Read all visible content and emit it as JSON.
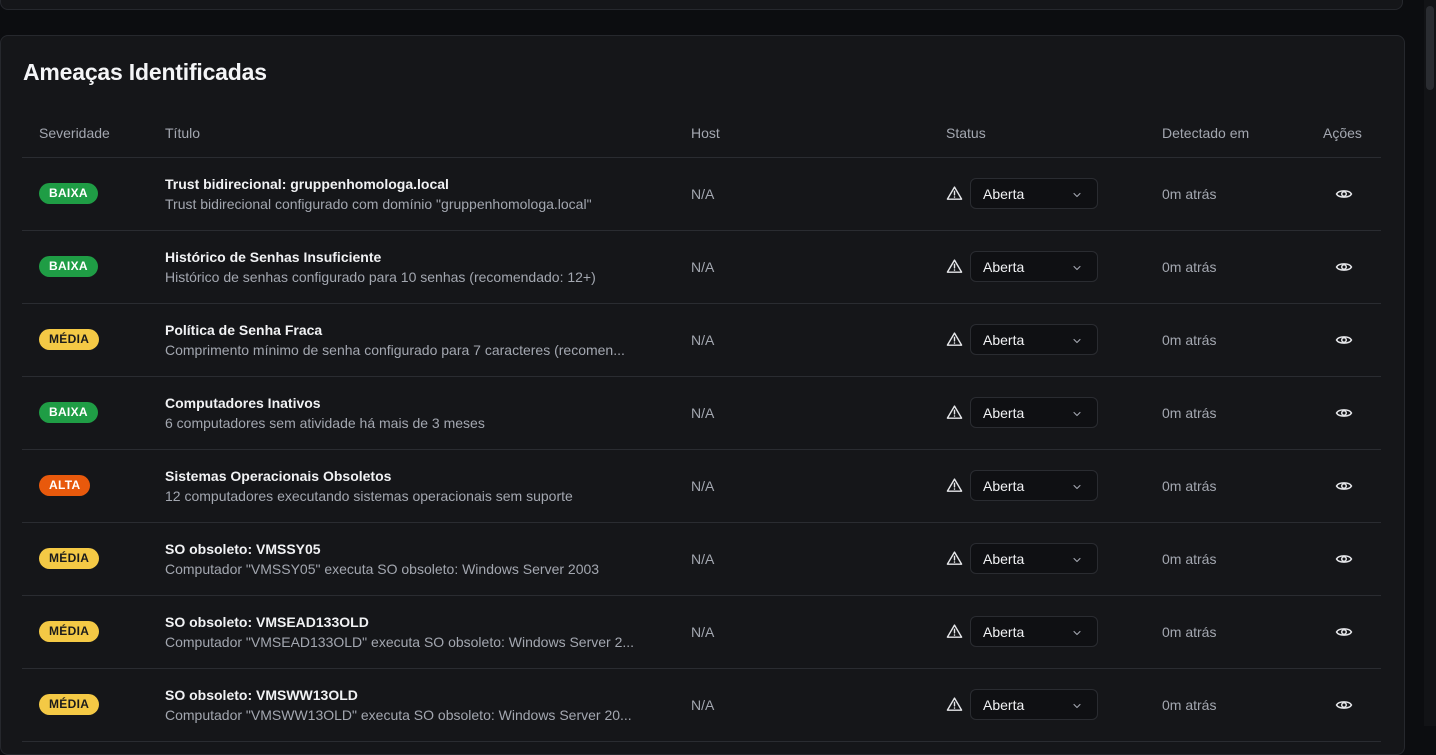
{
  "section": {
    "title": "Ameaças Identificadas"
  },
  "columns": {
    "severity": "Severidade",
    "title": "Título",
    "host": "Host",
    "status": "Status",
    "detected": "Detectado em",
    "actions": "Ações"
  },
  "icons": {
    "warning": "alert-triangle-icon",
    "view": "eye-icon",
    "dropdown": "chevron-down-icon"
  },
  "colors": {
    "baixa": "#1f9d45",
    "media": "#f4c945",
    "alta": "#e8590c"
  },
  "threats": [
    {
      "severity": "BAIXA",
      "level": "baixa",
      "title": "Trust bidirecional: gruppenhomologa.local",
      "description": "Trust bidirecional configurado com domínio \"gruppenhomologa.local\"",
      "host": "N/A",
      "status": "Aberta",
      "detected": "0m atrás"
    },
    {
      "severity": "BAIXA",
      "level": "baixa",
      "title": "Histórico de Senhas Insuficiente",
      "description": "Histórico de senhas configurado para 10 senhas (recomendado: 12+)",
      "host": "N/A",
      "status": "Aberta",
      "detected": "0m atrás"
    },
    {
      "severity": "MÉDIA",
      "level": "media",
      "title": "Política de Senha Fraca",
      "description": "Comprimento mínimo de senha configurado para 7 caracteres (recomen...",
      "host": "N/A",
      "status": "Aberta",
      "detected": "0m atrás"
    },
    {
      "severity": "BAIXA",
      "level": "baixa",
      "title": "Computadores Inativos",
      "description": "6 computadores sem atividade há mais de 3 meses",
      "host": "N/A",
      "status": "Aberta",
      "detected": "0m atrás"
    },
    {
      "severity": "ALTA",
      "level": "alta",
      "title": "Sistemas Operacionais Obsoletos",
      "description": "12 computadores executando sistemas operacionais sem suporte",
      "host": "N/A",
      "status": "Aberta",
      "detected": "0m atrás"
    },
    {
      "severity": "MÉDIA",
      "level": "media",
      "title": "SO obsoleto: VMSSY05",
      "description": "Computador \"VMSSY05\" executa SO obsoleto: Windows Server 2003",
      "host": "N/A",
      "status": "Aberta",
      "detected": "0m atrás"
    },
    {
      "severity": "MÉDIA",
      "level": "media",
      "title": "SO obsoleto: VMSEAD133OLD",
      "description": "Computador \"VMSEAD133OLD\" executa SO obsoleto: Windows Server 2...",
      "host": "N/A",
      "status": "Aberta",
      "detected": "0m atrás"
    },
    {
      "severity": "MÉDIA",
      "level": "media",
      "title": "SO obsoleto: VMSWW13OLD",
      "description": "Computador \"VMSWW13OLD\" executa SO obsoleto: Windows Server 20...",
      "host": "N/A",
      "status": "Aberta",
      "detected": "0m atrás"
    }
  ]
}
